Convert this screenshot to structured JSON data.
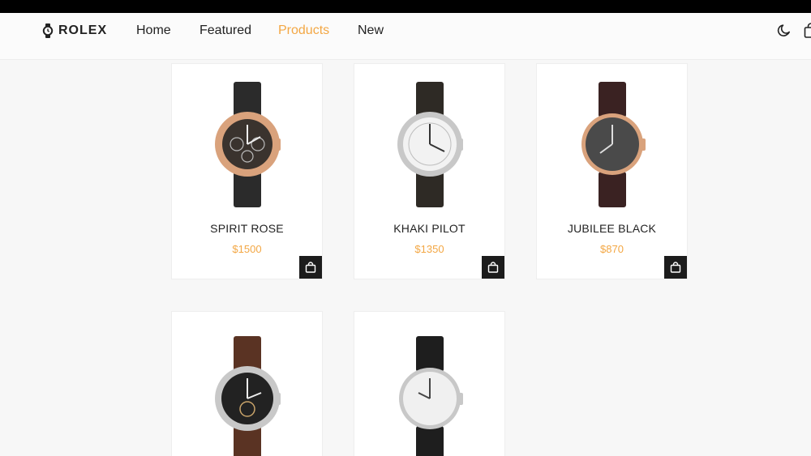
{
  "brand": {
    "name": "ROLEX",
    "icon": "watch-icon"
  },
  "nav": {
    "items": [
      {
        "label": "Home",
        "active": false
      },
      {
        "label": "Featured",
        "active": false
      },
      {
        "label": "Products",
        "active": true
      },
      {
        "label": "New",
        "active": false
      }
    ],
    "theme_icon": "moon-icon",
    "cart_icon": "shopping-bag-icon"
  },
  "colors": {
    "accent": "#f3a744",
    "text": "#222222",
    "button": "#1c1c1c",
    "background": "#f7f7f7"
  },
  "products": [
    {
      "name": "SPIRIT ROSE",
      "price": "$1500",
      "strap": "#2b2b2b",
      "case": "#d9a27c",
      "dial": "#3a332e"
    },
    {
      "name": "KHAKI PILOT",
      "price": "$1350",
      "strap": "#2e2a25",
      "case": "#c8c8c8",
      "dial": "#f2f2f2"
    },
    {
      "name": "JUBILEE BLACK",
      "price": "$870",
      "strap": "#3a2222",
      "case": "#d9a27c",
      "dial": "#4a4a4a"
    },
    {
      "name": "",
      "price": "",
      "strap": "#5a3323",
      "case": "#c8c8c8",
      "dial": "#222222"
    },
    {
      "name": "",
      "price": "",
      "strap": "#1e1e1e",
      "case": "#c8c8c8",
      "dial": "#f0f0f0"
    }
  ]
}
